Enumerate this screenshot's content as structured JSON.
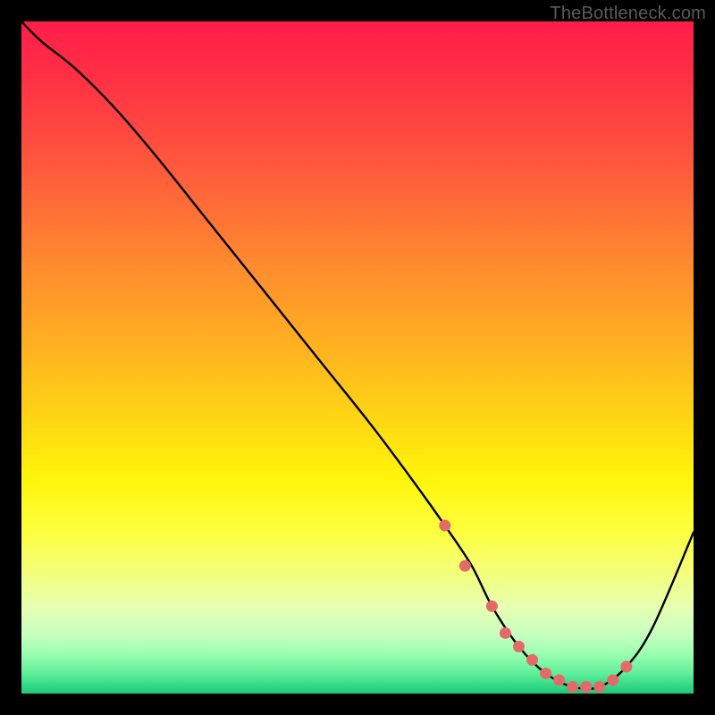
{
  "watermark": "TheBottleneck.com",
  "chart_data": {
    "type": "line",
    "title": "",
    "xlabel": "",
    "ylabel": "",
    "xlim": [
      0,
      100
    ],
    "ylim": [
      0,
      100
    ],
    "series": [
      {
        "name": "curve",
        "x": [
          0,
          3,
          8,
          14,
          20,
          28,
          36,
          44,
          52,
          58,
          63,
          67,
          70,
          74,
          78,
          82,
          86,
          90,
          94,
          100
        ],
        "y": [
          100,
          97,
          93,
          87,
          80,
          70,
          60,
          50,
          40,
          32,
          25,
          19,
          13,
          7,
          3,
          1,
          1,
          4,
          10,
          24
        ]
      }
    ],
    "markers": {
      "name": "dots",
      "color": "#e46a6a",
      "x": [
        63,
        66,
        70,
        72,
        74,
        76,
        78,
        80,
        82,
        84,
        86,
        88,
        90
      ],
      "y": [
        25,
        19,
        13,
        9,
        7,
        5,
        3,
        2,
        1,
        1,
        1,
        2,
        4
      ]
    }
  }
}
